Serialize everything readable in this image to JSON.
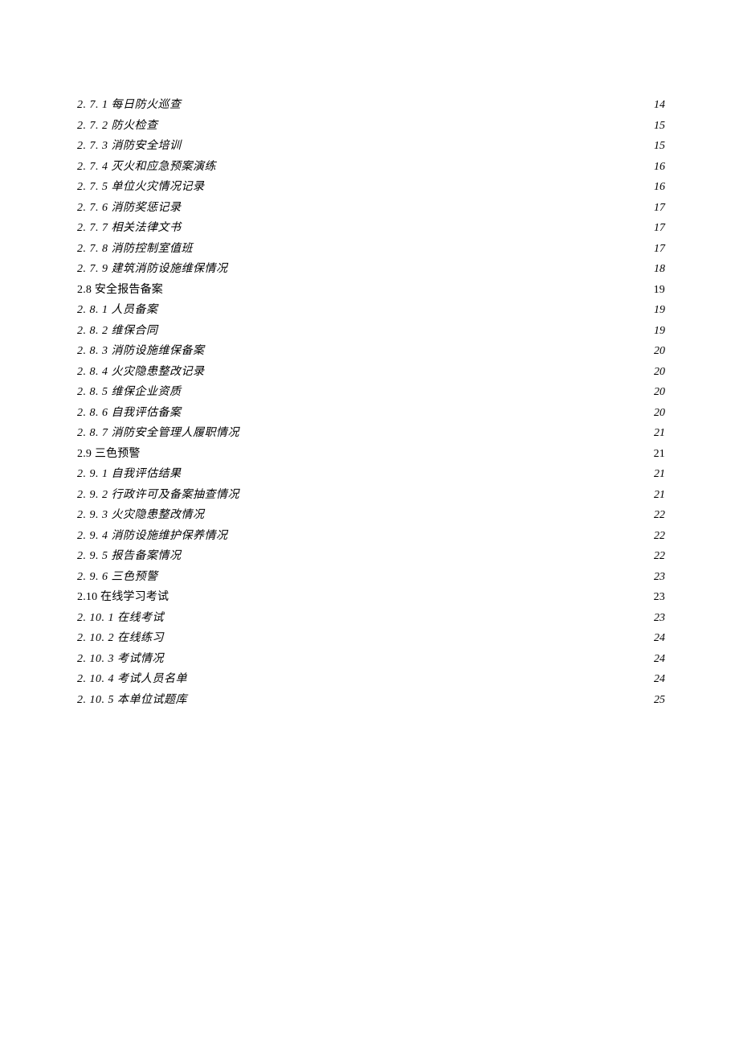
{
  "toc": [
    {
      "number": "2. 7. 1",
      "title": "每日防火巡查",
      "page": "14",
      "level": 3,
      "italic": true
    },
    {
      "number": "2. 7. 2",
      "title": "防火检查",
      "page": "15",
      "level": 3,
      "italic": true
    },
    {
      "number": "2. 7. 3",
      "title": "消防安全培训",
      "page": "15",
      "level": 3,
      "italic": true
    },
    {
      "number": "2. 7. 4",
      "title": "灭火和应急预案演练",
      "page": "16",
      "level": 3,
      "italic": true
    },
    {
      "number": "2. 7. 5",
      "title": "单位火灾情况记录",
      "page": "16",
      "level": 3,
      "italic": true
    },
    {
      "number": "2. 7. 6",
      "title": "消防奖惩记录",
      "page": "17",
      "level": 3,
      "italic": true
    },
    {
      "number": "2. 7. 7",
      "title": "相关法律文书",
      "page": "17",
      "level": 3,
      "italic": true
    },
    {
      "number": "2. 7. 8",
      "title": "消防控制室值班",
      "page": "17",
      "level": 3,
      "italic": true
    },
    {
      "number": "2. 7. 9",
      "title": "建筑消防设施维保情况",
      "page": "18",
      "level": 3,
      "italic": true
    },
    {
      "number": "2.8",
      "title": "安全报告备案",
      "page": "19",
      "level": 2,
      "italic": false
    },
    {
      "number": "2. 8. 1",
      "title": "人员备案",
      "page": "19",
      "level": 3,
      "italic": true
    },
    {
      "number": "2. 8. 2",
      "title": "维保合同",
      "page": "19",
      "level": 3,
      "italic": true
    },
    {
      "number": "2. 8. 3",
      "title": "消防设施维保备案",
      "page": "20",
      "level": 3,
      "italic": true
    },
    {
      "number": "2. 8. 4",
      "title": "火灾隐患整改记录",
      "page": "20",
      "level": 3,
      "italic": true
    },
    {
      "number": "2. 8. 5",
      "title": "维保企业资质",
      "page": "20",
      "level": 3,
      "italic": true
    },
    {
      "number": "2. 8. 6",
      "title": "自我评估备案",
      "page": "20",
      "level": 3,
      "italic": true
    },
    {
      "number": "2. 8. 7",
      "title": "消防安全管理人履职情况",
      "page": "21",
      "level": 3,
      "italic": true
    },
    {
      "number": "2.9",
      "title": "三色预警",
      "page": "21",
      "level": 2,
      "italic": false
    },
    {
      "number": "2. 9. 1",
      "title": "自我评估结果",
      "page": "21",
      "level": 3,
      "italic": true
    },
    {
      "number": "2. 9. 2",
      "title": "行政许可及备案抽查情况",
      "page": "21",
      "level": 3,
      "italic": true
    },
    {
      "number": "2. 9. 3",
      "title": "火灾隐患整改情况",
      "page": "22",
      "level": 3,
      "italic": true
    },
    {
      "number": "2. 9. 4",
      "title": "消防设施维护保养情况",
      "page": "22",
      "level": 3,
      "italic": true
    },
    {
      "number": "2. 9. 5",
      "title": "报告备案情况",
      "page": "22",
      "level": 3,
      "italic": true
    },
    {
      "number": "2. 9. 6",
      "title": "三色预警",
      "page": "23",
      "level": 3,
      "italic": true
    },
    {
      "number": "2.10",
      "title": "在线学习考试",
      "page": "23",
      "level": 2,
      "italic": false
    },
    {
      "number": "2. 10. 1",
      "title": "在线考试",
      "page": "23",
      "level": 3,
      "italic": true
    },
    {
      "number": "2. 10. 2",
      "title": "在线练习",
      "page": "24",
      "level": 3,
      "italic": true
    },
    {
      "number": "2. 10. 3",
      "title": "考试情况",
      "page": "24",
      "level": 3,
      "italic": true
    },
    {
      "number": "2. 10. 4",
      "title": "考试人员名单",
      "page": "24",
      "level": 3,
      "italic": true
    },
    {
      "number": "2. 10. 5",
      "title": "本单位试题库",
      "page": "25",
      "level": 3,
      "italic": true
    }
  ]
}
